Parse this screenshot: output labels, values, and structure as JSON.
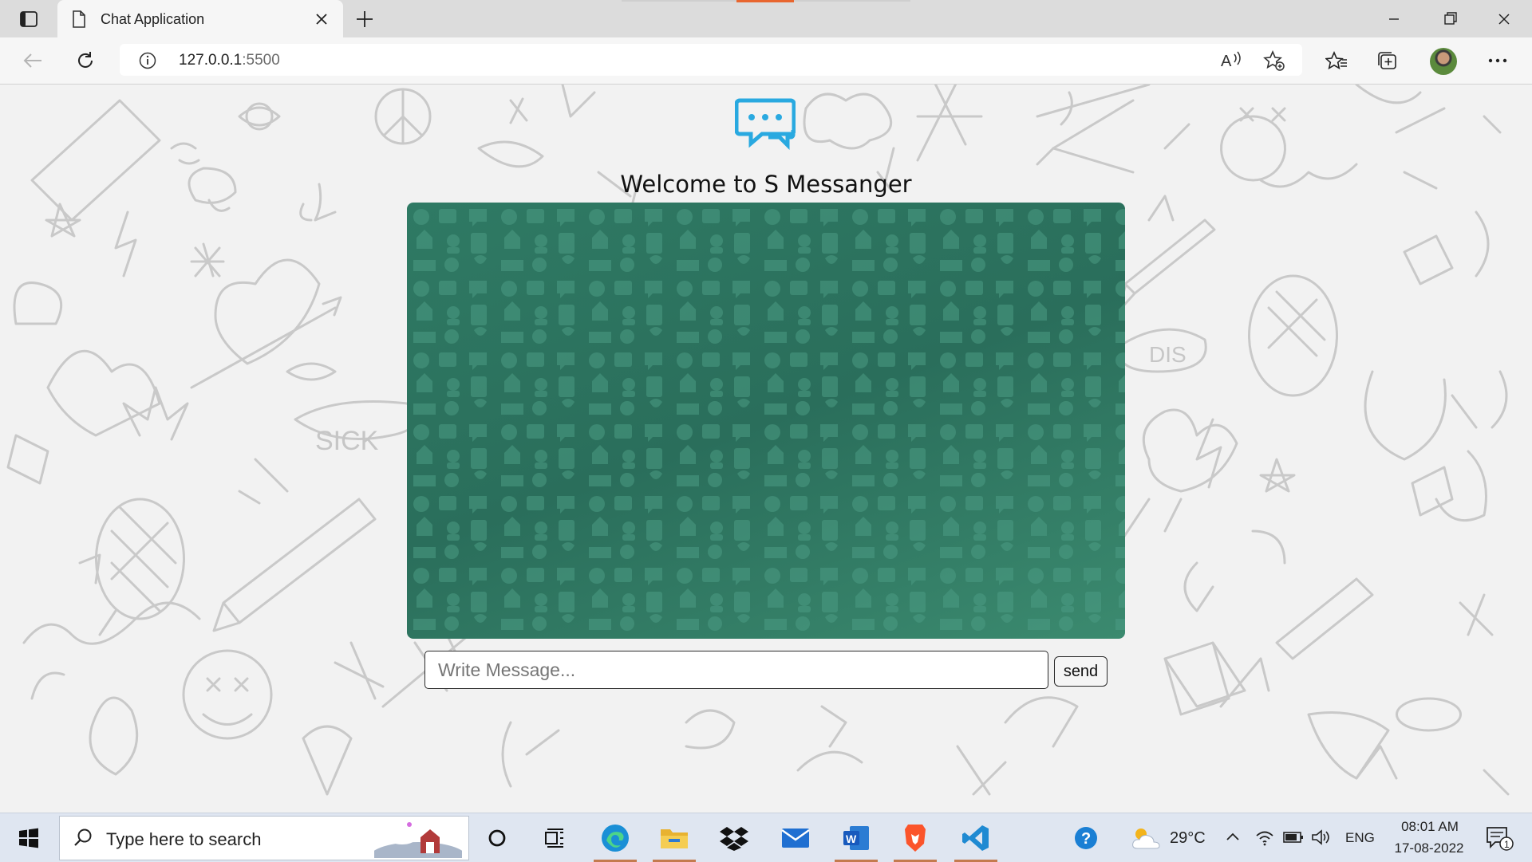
{
  "browser": {
    "tab_title": "Chat Application",
    "address_host": "127.0.0.1",
    "address_port": ":5500"
  },
  "page": {
    "heading": "Welcome to S Messanger",
    "input_placeholder": "Write Message...",
    "send_label": "send",
    "colors": {
      "chat_bg": "#2f7a64",
      "logo": "#29a9e0",
      "page_bg": "#f2f2f2"
    }
  },
  "taskbar": {
    "search_placeholder": "Type here to search",
    "pinned_icons": [
      "cortana-icon",
      "task-view-icon",
      "edge-icon",
      "file-explorer-icon",
      "dropbox-icon",
      "mail-icon",
      "word-icon",
      "brave-icon",
      "vscode-icon",
      "help-icon"
    ],
    "temperature": "29°C",
    "language": "ENG",
    "time": "08:01 AM",
    "date": "17-08-2022",
    "notification_count": "1"
  }
}
